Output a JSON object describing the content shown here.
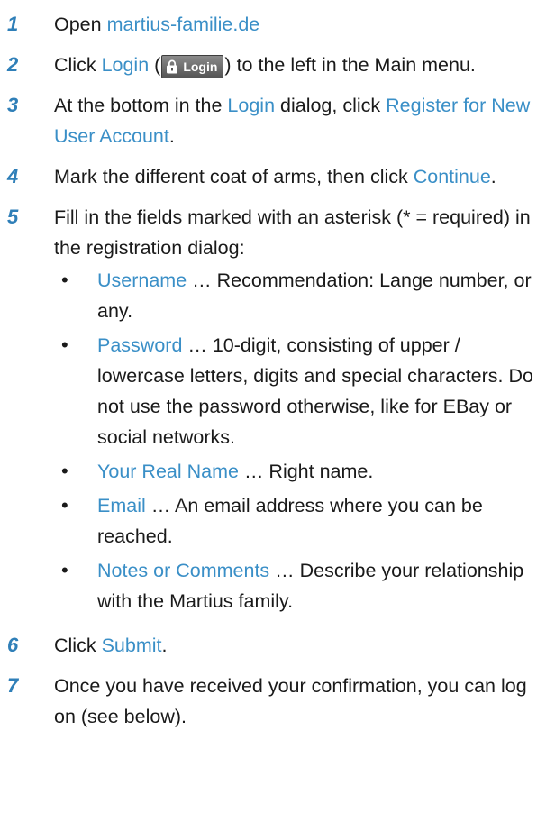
{
  "steps": [
    {
      "number": "1",
      "prefix": "Open ",
      "link": "martius-familie.de",
      "suffix": ""
    },
    {
      "number": "2",
      "prefix": "Click ",
      "link": "Login",
      "badge_open": " (",
      "badge_label": "Login",
      "badge_close": ")",
      "suffix": " to the left in the Main menu."
    },
    {
      "number": "3",
      "prefix": "At the bottom in the ",
      "link": "Login",
      "middle": " dialog, click ",
      "link2": "Register for New User Account",
      "suffix": "."
    },
    {
      "number": "4",
      "prefix": "Mark the different coat of arms, then click ",
      "link": "Continue",
      "suffix": "."
    },
    {
      "number": "5",
      "text": "Fill in the fields marked with an asterisk (* = required) in the registration dialog:",
      "fields": [
        {
          "name": "Username",
          "desc": " … Recommendation: Lange number, or any."
        },
        {
          "name": "Password",
          "desc": " … 10-digit, consisting of upper / lowercase letters, digits and special characters. Do not use the password otherwise, like for EBay or social networks."
        },
        {
          "name": "Your Real Name",
          "desc": " … Right name."
        },
        {
          "name": "Email",
          "desc": " … An email address where you can be reached."
        },
        {
          "name": "Notes or Comments",
          "desc": " … Describe your relationship with the Martius family."
        }
      ]
    },
    {
      "number": "6",
      "prefix": "Click ",
      "link": "Submit",
      "suffix": "."
    },
    {
      "number": "7",
      "text": "Once you have received your confirmation, you can log on (see below)."
    }
  ],
  "bullet_char": "•",
  "colors": {
    "step_number": "#2f7fb8",
    "link": "#3a8fc7",
    "text": "#1a1a1a"
  },
  "icons": {
    "login_badge_icon": "lock-icon"
  }
}
